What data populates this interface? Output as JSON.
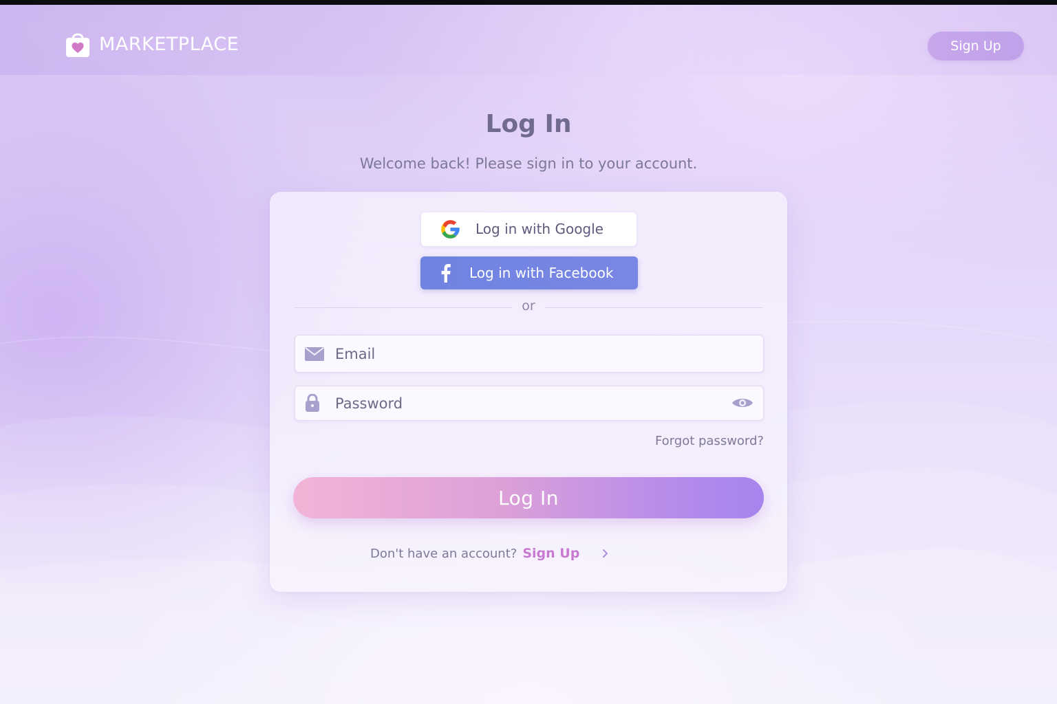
{
  "brand": {
    "name": "MARKETPLACE",
    "logo_icon": "shopping-bag-heart-icon"
  },
  "header": {
    "signup_label": "Sign Up"
  },
  "page": {
    "title": "Log In",
    "subtitle": "Welcome back! Please sign in to your account."
  },
  "social": {
    "google_label": "Log in with Google",
    "google_icon": "google-g-icon",
    "facebook_label": "Log in with Facebook",
    "facebook_icon": "facebook-f-icon",
    "facebook_color": "#7182e1"
  },
  "divider": {
    "text": "or"
  },
  "form": {
    "email_placeholder": "Email",
    "email_icon": "envelope-icon",
    "password_placeholder": "Password",
    "password_icon": "lock-icon",
    "password_toggle_icon": "eye-icon",
    "forgot_label": "Forgot password?",
    "submit_label": "Log In"
  },
  "footer": {
    "question": "Don't have an account?",
    "signup_link": "Sign Up",
    "signup_chevron_icon": "chevron-right-icon"
  },
  "colors": {
    "accent_pink": "#f2b4d6",
    "accent_purple": "#a585ec",
    "link": "#c87ad2",
    "text": "#6f6a8e"
  }
}
